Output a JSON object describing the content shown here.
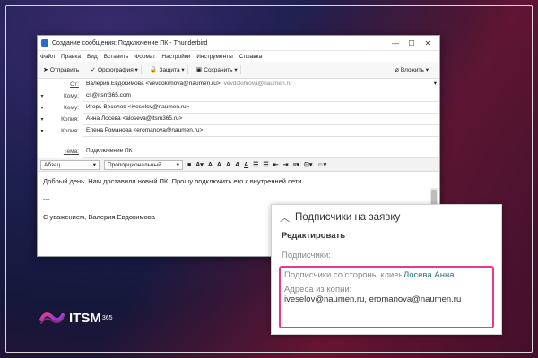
{
  "window": {
    "title": "Создание сообщения: Подключение ПК - Thunderbird",
    "controls": [
      "—",
      "☐",
      "✕"
    ]
  },
  "menu": [
    "Файл",
    "Правка",
    "Вид",
    "Вставить",
    "Формат",
    "Настройки",
    "Инструменты",
    "Справка"
  ],
  "toolbar": {
    "send": "Отправить",
    "spelling": "Орфография",
    "security": "Защита",
    "save": "Сохранить",
    "attach": "Вложить"
  },
  "headers": {
    "from_label": "От:",
    "from_value": "Валерия Евдокимова <vevdokimova@naumen.ru>",
    "from_extra": "vevdokimova@naumen.ru",
    "to_label": "Кому:",
    "to1": "cs@itsm365.com",
    "to2": "Игорь  Веселов <iveselov@naumen.ru>",
    "cc_label": "Копия:",
    "cc1": "Анна  Лосева <aloseva@itsm365.ru>",
    "cc2": "Елена  Романова <eromanova@naumen.ru>",
    "subject_label": "Тема:",
    "subject_value": "Подключение ПК"
  },
  "format": {
    "para": "Абзац",
    "font": "Пропорциональный"
  },
  "body": {
    "line1": "Добрый день. Нам доставили новый ПК. Прошу подключить его к внутренней сети.",
    "line2": "---",
    "line3": "С уважением, Валерия Евдокимова"
  },
  "panel": {
    "title": "Подписчики на заявку",
    "edit": "Редактировать",
    "subscribers": "Подписчики:",
    "client_label": "Подписчики со стороны клиента:",
    "client_name": "Лосева Анна",
    "copy_label": "Адреса из копии:",
    "copy_emails": "iveselov@naumen.ru, eromanova@naumen.ru"
  },
  "logo": {
    "text": "ITSM",
    "sup": "365"
  },
  "colors": {
    "highlight": "#e8398f",
    "link": "#2a6f7a"
  }
}
